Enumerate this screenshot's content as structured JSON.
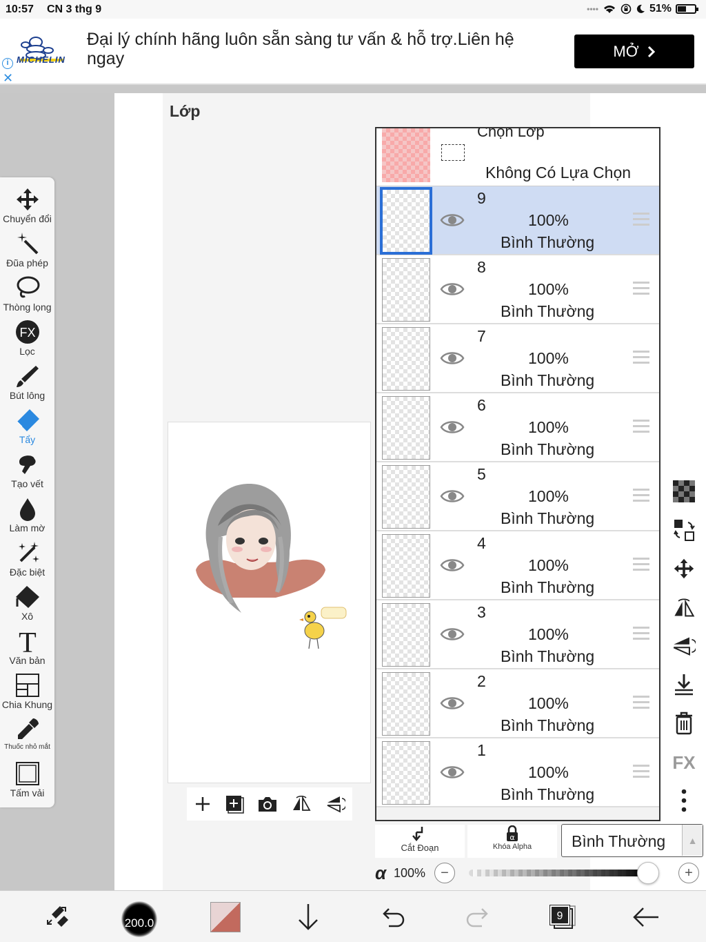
{
  "status": {
    "time": "10:57",
    "date": "CN 3 thg 9",
    "battery": "51%",
    "battery_level": 0.51
  },
  "ad": {
    "brand": "MICHELIN",
    "text": "Đại lý chính hãng luôn sẵn sàng tư vấn & hỗ trợ.Liên hệ ngay",
    "button": "MỞ"
  },
  "panel": {
    "title": "Lớp"
  },
  "left_tools": [
    {
      "label": "Chuyển đổi",
      "icon": "move-arrows-icon"
    },
    {
      "label": "Đũa phép",
      "icon": "magic-wand-icon"
    },
    {
      "label": "Thòng lọng",
      "icon": "lasso-icon"
    },
    {
      "label": "Lọc",
      "icon": "fx-filter-icon"
    },
    {
      "label": "Bút lông",
      "icon": "brush-icon"
    },
    {
      "label": "Tẩy",
      "icon": "eraser-icon",
      "active": true
    },
    {
      "label": "Tạo vết",
      "icon": "smudge-icon"
    },
    {
      "label": "Làm mờ",
      "icon": "blur-drop-icon"
    },
    {
      "label": "Đặc biệt",
      "icon": "special-sparkle-icon"
    },
    {
      "label": "Xô",
      "icon": "bucket-icon"
    },
    {
      "label": "Văn bản",
      "icon": "text-icon"
    },
    {
      "label": "Chia Khung",
      "icon": "frame-divide-icon"
    },
    {
      "label": "Thuốc nhỏ mắt",
      "icon": "eyedropper-icon"
    },
    {
      "label": "Tấm vải",
      "icon": "canvas-icon"
    }
  ],
  "selection_row": {
    "title": "Chọn Lớp",
    "none": "Không Có Lựa Chọn"
  },
  "layers": [
    {
      "num": "9",
      "opacity": "100%",
      "mode": "Bình Thường",
      "selected": true
    },
    {
      "num": "8",
      "opacity": "100%",
      "mode": "Bình Thường"
    },
    {
      "num": "7",
      "opacity": "100%",
      "mode": "Bình Thường"
    },
    {
      "num": "6",
      "opacity": "100%",
      "mode": "Bình Thường"
    },
    {
      "num": "5",
      "opacity": "100%",
      "mode": "Bình Thường"
    },
    {
      "num": "4",
      "opacity": "100%",
      "mode": "Bình Thường"
    },
    {
      "num": "3",
      "opacity": "100%",
      "mode": "Bình Thường"
    },
    {
      "num": "2",
      "opacity": "100%",
      "mode": "Bình Thường"
    },
    {
      "num": "1",
      "opacity": "100%",
      "mode": "Bình Thường"
    }
  ],
  "controls": {
    "clip": "Cắt Đoạn",
    "alpha_lock": "Khóa Alpha",
    "blend_mode": "Bình Thường",
    "alpha_symbol": "α",
    "alpha_value": "100%",
    "alpha_level": 1.0
  },
  "bottom": {
    "brush_size": "200.0",
    "layer_count": "9"
  },
  "colors": {
    "accent": "#2b89e0",
    "selected_layer": "#cfdcf3",
    "current_color": "#c26a5e"
  }
}
